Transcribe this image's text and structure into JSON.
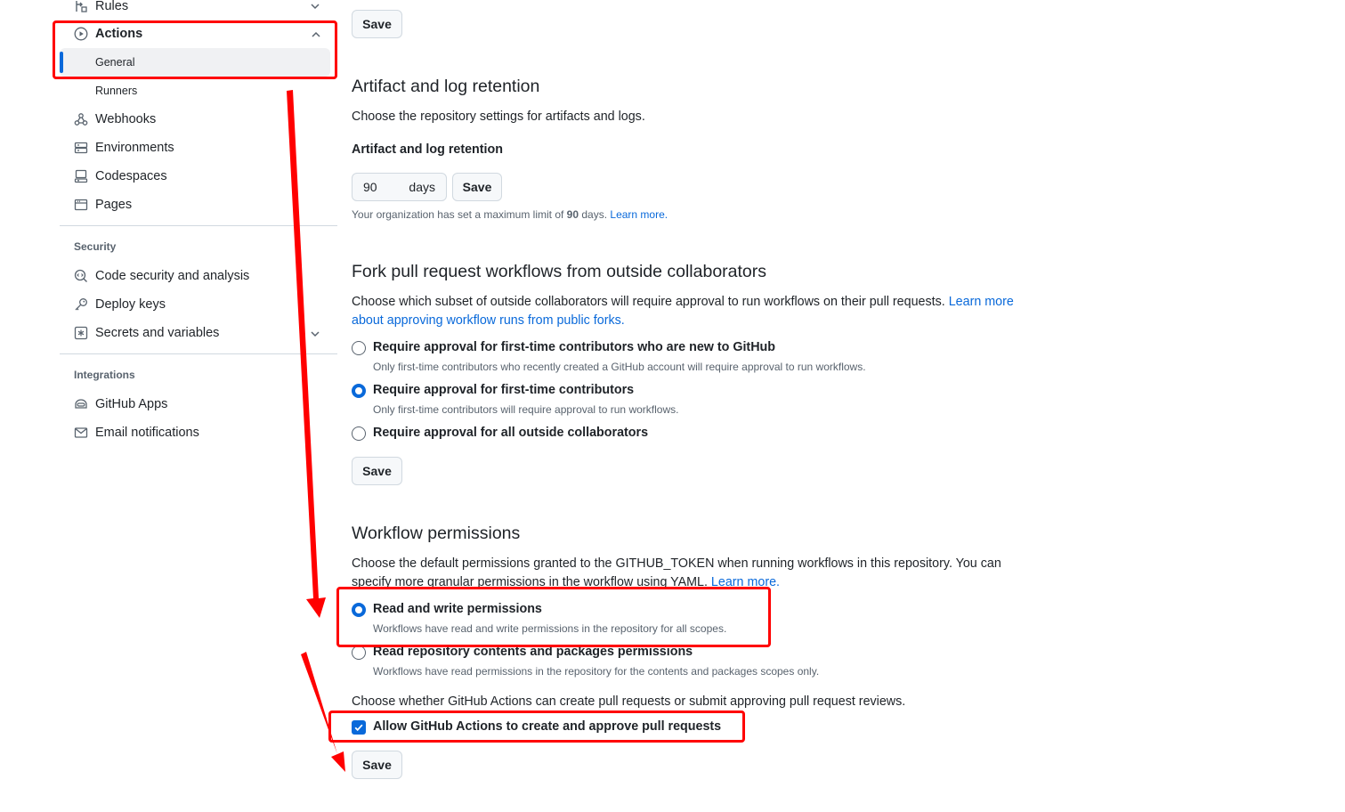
{
  "sidebar": {
    "rules_label": "Rules",
    "actions_label": "Actions",
    "actions_sub": [
      "General",
      "Runners"
    ],
    "items_top": [
      {
        "label": "Webhooks",
        "icon": "webhook-icon"
      },
      {
        "label": "Environments",
        "icon": "server-icon"
      },
      {
        "label": "Codespaces",
        "icon": "codespaces-icon"
      },
      {
        "label": "Pages",
        "icon": "browser-icon"
      }
    ],
    "security_heading": "Security",
    "security_items": [
      {
        "label": "Code security and analysis",
        "icon": "codescan-icon"
      },
      {
        "label": "Deploy keys",
        "icon": "key-icon"
      },
      {
        "label": "Secrets and variables",
        "icon": "key-asterisk-icon"
      }
    ],
    "integrations_heading": "Integrations",
    "integrations_items": [
      {
        "label": "GitHub Apps",
        "icon": "hubot-icon"
      },
      {
        "label": "Email notifications",
        "icon": "mail-icon"
      }
    ]
  },
  "main": {
    "save_label": "Save",
    "artifact": {
      "title": "Artifact and log retention",
      "description": "Choose the repository settings for artifacts and logs.",
      "field_label": "Artifact and log retention",
      "days_value": "90",
      "days_unit": "days",
      "note_prefix": "Your organization has set a maximum limit of ",
      "note_value": "90",
      "note_suffix": " days. ",
      "note_link": "Learn more."
    },
    "fork": {
      "title": "Fork pull request workflows from outside collaborators",
      "description": "Choose which subset of outside collaborators will require approval to run workflows on their pull requests. ",
      "description_link_1": "Learn more",
      "description_link_2": "about approving workflow runs from public forks.",
      "options": [
        {
          "label": "Require approval for first-time contributors who are new to GitHub",
          "desc": "Only first-time contributors who recently created a GitHub account will require approval to run workflows.",
          "checked": false
        },
        {
          "label": "Require approval for first-time contributors",
          "desc": "Only first-time contributors will require approval to run workflows.",
          "checked": true
        },
        {
          "label": "Require approval for all outside collaborators",
          "desc": "",
          "checked": false
        }
      ]
    },
    "workflow": {
      "title": "Workflow permissions",
      "description_line1": "Choose the default permissions granted to the GITHUB_TOKEN when running workflows in this repository. You can",
      "description_line2": "specify more granular permissions in the workflow using YAML. ",
      "description_link": "Learn more.",
      "options": [
        {
          "label": "Read and write permissions",
          "desc": "Workflows have read and write permissions in the repository for all scopes.",
          "checked": true
        },
        {
          "label": "Read repository contents and packages permissions",
          "desc": "Workflows have read permissions in the repository for the contents and packages scopes only.",
          "checked": false
        }
      ],
      "pr_question": "Choose whether GitHub Actions can create pull requests or submit approving pull request reviews.",
      "allow_pr_label": "Allow GitHub Actions to create and approve pull requests",
      "allow_pr_checked": true
    }
  },
  "annotation_color": "#ff0000",
  "accent_color": "#0969da"
}
